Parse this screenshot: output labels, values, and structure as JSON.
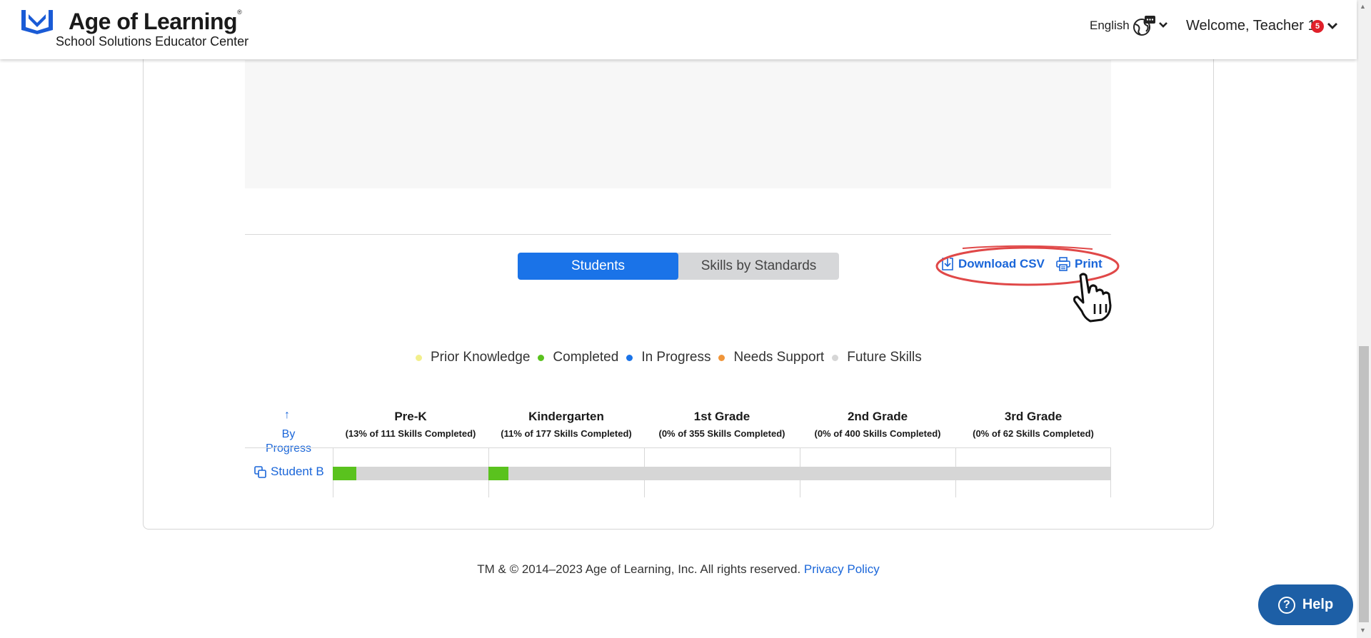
{
  "header": {
    "brand_name": "Age of Learning",
    "brand_mark": "®",
    "brand_subtitle": "School Solutions Educator Center",
    "language": "English",
    "welcome": "Welcome, Teacher 1",
    "notification_count": "5"
  },
  "report": {
    "tabs": [
      {
        "label": "Students",
        "active": true
      },
      {
        "label": "Skills by Standards",
        "active": false
      }
    ],
    "download_csv_label": "Download CSV",
    "print_label": "Print"
  },
  "legend": [
    {
      "label": "Prior Knowledge",
      "color": "#f2ef8c"
    },
    {
      "label": "Completed",
      "color": "#5ac21e"
    },
    {
      "label": "In Progress",
      "color": "#1a73e8"
    },
    {
      "label": "Needs Support",
      "color": "#f0953a"
    },
    {
      "label": "Future Skills",
      "color": "#d6d6d6"
    }
  ],
  "table": {
    "sort_arrow": "↑",
    "sort_label": "By Progress",
    "grades": [
      {
        "name": "Pre-K",
        "summary": "(13% of 111 Skills Completed)"
      },
      {
        "name": "Kindergarten",
        "summary": "(11% of 177 Skills Completed)"
      },
      {
        "name": "1st Grade",
        "summary": "(0% of 355 Skills Completed)"
      },
      {
        "name": "2nd Grade",
        "summary": "(0% of 400 Skills Completed)"
      },
      {
        "name": "3rd Grade",
        "summary": "(0% of 62 Skills Completed)"
      }
    ],
    "students": [
      {
        "name": "Student B",
        "completed_fraction": [
          0.13,
          0.11,
          0,
          0,
          0
        ]
      }
    ]
  },
  "footer": {
    "copyright": "TM & © 2014–2023 Age of Learning, Inc. All rights reserved.",
    "privacy_label": "Privacy Policy"
  },
  "help": {
    "label": "Help",
    "icon": "?"
  },
  "colors": {
    "accent": "#1a73e8",
    "link": "#1a66d9",
    "help": "#1d5fa6",
    "notification": "#e0202a"
  }
}
